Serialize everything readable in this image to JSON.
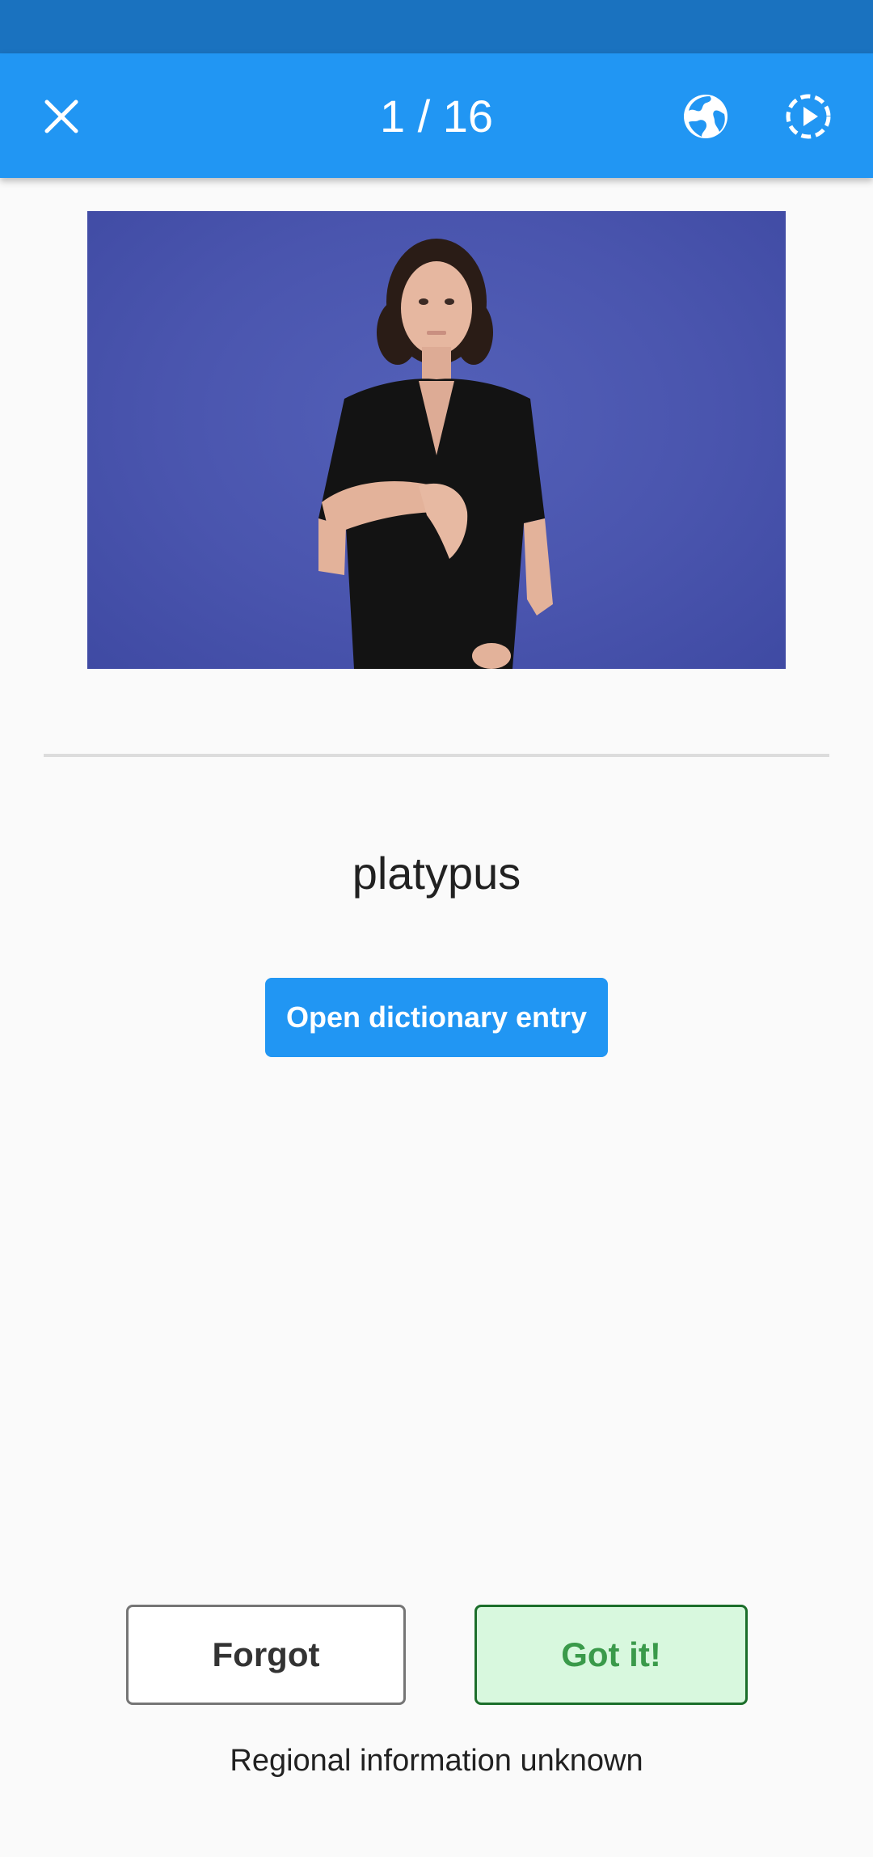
{
  "app_bar": {
    "counter": "1 / 16",
    "close_icon": "close-icon",
    "globe_icon": "globe-icon",
    "autoplay_icon": "autoplay-icon"
  },
  "card": {
    "video_icon": "signing-video",
    "word": "platypus",
    "dictionary_button": "Open dictionary entry"
  },
  "actions": {
    "forgot_label": "Forgot",
    "got_it_label": "Got it!"
  },
  "footer": {
    "region_text": "Regional information unknown"
  },
  "colors": {
    "primary": "#2196f3",
    "status_bar": "#1a72bf",
    "got_it_bg": "#d8f8de",
    "got_it_text": "#3a9a4a"
  }
}
